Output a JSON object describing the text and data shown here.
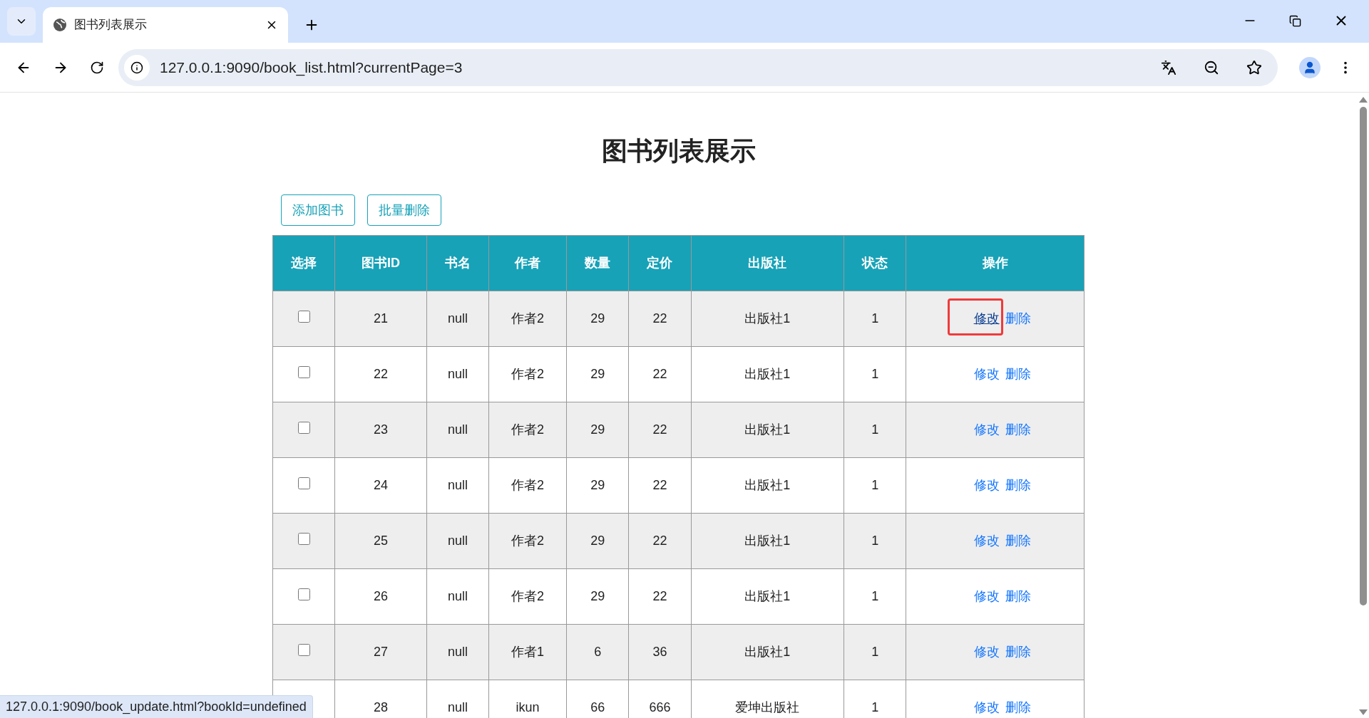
{
  "browser": {
    "tab_title": "图书列表展示",
    "url": "127.0.0.1:9090/book_list.html?currentPage=3",
    "status_url": "127.0.0.1:9090/book_update.html?bookId=undefined"
  },
  "page": {
    "title": "图书列表展示",
    "buttons": [
      "添加图书",
      "批量删除"
    ]
  },
  "table": {
    "columns": [
      "选择",
      "图书ID",
      "书名",
      "作者",
      "数量",
      "定价",
      "出版社",
      "状态",
      "操作"
    ],
    "rows": [
      {
        "checked": false,
        "id": "21",
        "name": "null",
        "author": "作者2",
        "count": "29",
        "price": "22",
        "publisher": "出版社1",
        "status": "1",
        "edit": "修改",
        "delete": "删除",
        "edit_hovered": true,
        "highlighted": true
      },
      {
        "checked": false,
        "id": "22",
        "name": "null",
        "author": "作者2",
        "count": "29",
        "price": "22",
        "publisher": "出版社1",
        "status": "1",
        "edit": "修改",
        "delete": "删除",
        "edit_hovered": false,
        "highlighted": false
      },
      {
        "checked": false,
        "id": "23",
        "name": "null",
        "author": "作者2",
        "count": "29",
        "price": "22",
        "publisher": "出版社1",
        "status": "1",
        "edit": "修改",
        "delete": "删除",
        "edit_hovered": false,
        "highlighted": false
      },
      {
        "checked": false,
        "id": "24",
        "name": "null",
        "author": "作者2",
        "count": "29",
        "price": "22",
        "publisher": "出版社1",
        "status": "1",
        "edit": "修改",
        "delete": "删除",
        "edit_hovered": false,
        "highlighted": false
      },
      {
        "checked": false,
        "id": "25",
        "name": "null",
        "author": "作者2",
        "count": "29",
        "price": "22",
        "publisher": "出版社1",
        "status": "1",
        "edit": "修改",
        "delete": "删除",
        "edit_hovered": false,
        "highlighted": false
      },
      {
        "checked": false,
        "id": "26",
        "name": "null",
        "author": "作者2",
        "count": "29",
        "price": "22",
        "publisher": "出版社1",
        "status": "1",
        "edit": "修改",
        "delete": "删除",
        "edit_hovered": false,
        "highlighted": false
      },
      {
        "checked": false,
        "id": "27",
        "name": "null",
        "author": "作者1",
        "count": "6",
        "price": "36",
        "publisher": "出版社1",
        "status": "1",
        "edit": "修改",
        "delete": "删除",
        "edit_hovered": false,
        "highlighted": false
      },
      {
        "id": "28",
        "name": "null",
        "author": "ikun",
        "count": "66",
        "price": "666",
        "publisher": "爱坤出版社",
        "status": "1",
        "edit": "修改",
        "delete": "删除",
        "edit_hovered": false,
        "highlighted": false
      }
    ]
  }
}
